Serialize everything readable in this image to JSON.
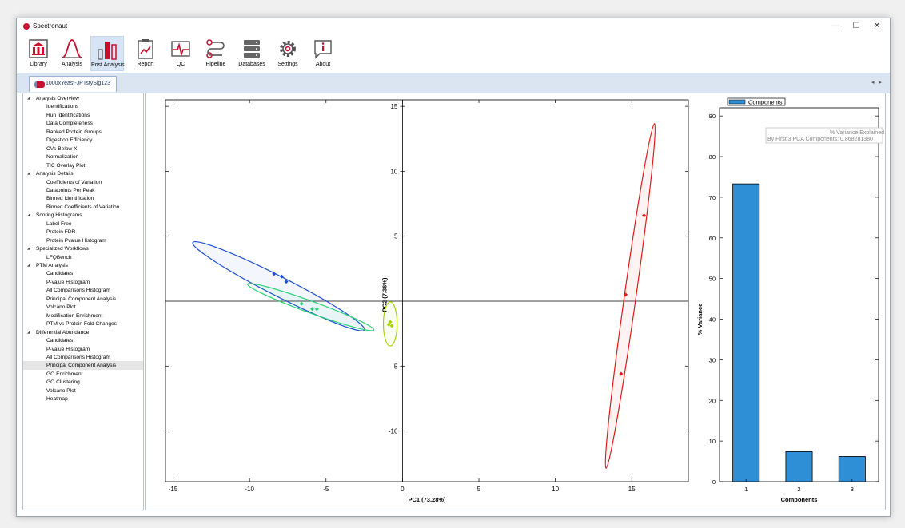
{
  "app": {
    "title": "Spectronaut"
  },
  "window_controls": {
    "minimize": "—",
    "maximize": "☐",
    "close": "✕"
  },
  "toolbar": [
    {
      "label": "Library",
      "icon": "library-icon"
    },
    {
      "label": "Analysis",
      "icon": "analysis-icon"
    },
    {
      "label": "Post Analysis",
      "icon": "post-analysis-icon",
      "active": true
    },
    {
      "label": "Report",
      "icon": "report-icon"
    },
    {
      "label": "QC",
      "icon": "qc-icon"
    },
    {
      "label": "Pipeline",
      "icon": "pipeline-icon"
    },
    {
      "label": "Databases",
      "icon": "databases-icon"
    },
    {
      "label": "Settings",
      "icon": "settings-icon"
    },
    {
      "label": "About",
      "icon": "about-icon"
    }
  ],
  "tab": {
    "label": "1000xYeast-JPTstySig123"
  },
  "nav_arrows": "◂ ▸",
  "sidebar": {
    "groups": [
      {
        "label": "Analysis Overview",
        "items": [
          "Identifications",
          "Run Identifications",
          "Data Completeness",
          "Ranked Protein Groups",
          "Digestion Efficiency",
          "CVs Below X",
          "Normalization",
          "TIC Overlay Plot"
        ]
      },
      {
        "label": "Analysis Details",
        "items": [
          "Coefficients of Variation",
          "Datapoints Per Peak",
          "Binned Identification",
          "Binned Coefficients of Variation"
        ]
      },
      {
        "label": "Scoring Histograms",
        "items": [
          "Label Free",
          "Protein FDR",
          "Protein Pvalue Histogram"
        ]
      },
      {
        "label": "Specialized Workflows",
        "items": [
          "LFQBench"
        ]
      },
      {
        "label": "PTM Analysis",
        "items": [
          "Candidates",
          "P-value Histogram",
          "All Comparisons Histogram",
          "Principal Component Analysis",
          "Volcano Plot",
          "Modification Enrichment",
          "PTM vs Protein Fold Changes"
        ]
      },
      {
        "label": "Differential Abundance",
        "items": [
          "Candidates",
          "P-value Histogram",
          "All Comparisons Histogram",
          "Principal Component Analysis",
          "GO Enrichment",
          "GO Clustering",
          "Volcano Plot",
          "Heatmap"
        ]
      }
    ],
    "selected": "Differential Abundance/Principal Component Analysis"
  },
  "chart_data": [
    {
      "type": "scatter",
      "xlabel": "PC1 (73.28%)",
      "ylabel": "PC2 (7.36%)",
      "xlim": [
        -15.5,
        18.7
      ],
      "ylim": [
        -13.9,
        15.5
      ],
      "xticks": [
        -15,
        -10,
        -5,
        0,
        5,
        10,
        15
      ],
      "yticks": [
        15,
        10,
        5,
        -5,
        -10
      ],
      "series": [
        {
          "color": "#1f4fd1",
          "points": [
            [
              -8.4,
              2.1
            ],
            [
              -7.9,
              1.9
            ],
            [
              -7.6,
              1.5
            ]
          ],
          "ellipse": {
            "cx": -8.1,
            "cy": 1.15,
            "rx": 6.3,
            "ry": 0.75,
            "angle_deg": 27
          }
        },
        {
          "color": "#2bd17a",
          "points": [
            [
              -6.6,
              -0.2
            ],
            [
              -5.9,
              -0.6
            ],
            [
              -5.6,
              -0.6
            ]
          ],
          "ellipse": {
            "cx": -6.0,
            "cy": -0.45,
            "rx": 4.4,
            "ry": 0.45,
            "angle_deg": 20
          }
        },
        {
          "color": "#a6d400",
          "points": [
            [
              -0.8,
              -1.6
            ],
            [
              -0.7,
              -1.9
            ],
            [
              -0.9,
              -1.8
            ]
          ],
          "ellipse": {
            "cx": -0.8,
            "cy": -1.75,
            "rx": 0.45,
            "ry": 1.7,
            "angle_deg": 0
          }
        },
        {
          "color": "#e01b1b",
          "points": [
            [
              15.8,
              6.6
            ],
            [
              14.6,
              0.5
            ],
            [
              14.3,
              -5.6
            ]
          ],
          "ellipse": {
            "cx": 14.9,
            "cy": 0.4,
            "rx": 0.38,
            "ry": 13.4,
            "angle_deg": 8
          }
        }
      ]
    },
    {
      "type": "bar",
      "categories": [
        "1",
        "2",
        "3"
      ],
      "values": [
        73.3,
        7.4,
        6.2
      ],
      "xlabel": "Components",
      "ylabel": "% Variance",
      "ylim": [
        0,
        92
      ],
      "yticks": [
        0,
        10,
        20,
        30,
        40,
        50,
        60,
        70,
        80,
        90
      ],
      "legend": "Components",
      "bar_color": "#2e8fd6",
      "annotation_title": "% Variance Explained",
      "annotation_text": "By First 3 PCA Components: 0.868281380"
    }
  ]
}
